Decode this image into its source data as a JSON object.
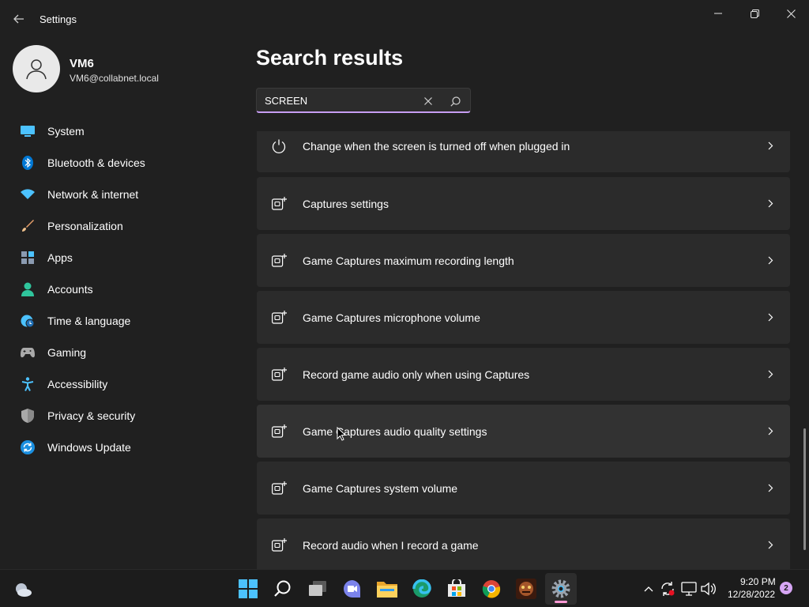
{
  "window": {
    "title": "Settings",
    "controls": [
      "minimize",
      "restore",
      "close"
    ]
  },
  "profile": {
    "name": "VM6",
    "email": "VM6@collabnet.local"
  },
  "sidebar": {
    "items": [
      {
        "label": "System",
        "icon": "system-icon"
      },
      {
        "label": "Bluetooth & devices",
        "icon": "bluetooth-icon"
      },
      {
        "label": "Network & internet",
        "icon": "wifi-icon"
      },
      {
        "label": "Personalization",
        "icon": "brush-icon"
      },
      {
        "label": "Apps",
        "icon": "apps-icon"
      },
      {
        "label": "Accounts",
        "icon": "person-icon"
      },
      {
        "label": "Time & language",
        "icon": "globe-clock-icon"
      },
      {
        "label": "Gaming",
        "icon": "gamepad-icon"
      },
      {
        "label": "Accessibility",
        "icon": "accessibility-icon"
      },
      {
        "label": "Privacy & security",
        "icon": "shield-icon"
      },
      {
        "label": "Windows Update",
        "icon": "update-icon"
      }
    ]
  },
  "main": {
    "title": "Search results",
    "search": {
      "value": "SCREEN"
    },
    "results": [
      {
        "label": "Change when the screen is turned off when plugged in",
        "icon": "power-icon"
      },
      {
        "label": "Captures settings",
        "icon": "capture-icon"
      },
      {
        "label": "Game Captures maximum recording length",
        "icon": "capture-icon"
      },
      {
        "label": "Game Captures microphone volume",
        "icon": "capture-icon"
      },
      {
        "label": "Record game audio only when using Captures",
        "icon": "capture-icon"
      },
      {
        "label": "Game Captures audio quality settings",
        "icon": "capture-icon"
      },
      {
        "label": "Game Captures system volume",
        "icon": "capture-icon"
      },
      {
        "label": "Record audio when I record a game",
        "icon": "capture-icon"
      }
    ]
  },
  "taskbar": {
    "apps": [
      "start-icon",
      "search-icon",
      "task-view-icon",
      "teams-chat-icon",
      "file-explorer-icon",
      "edge-icon",
      "store-icon",
      "chrome-icon",
      "game-app-icon",
      "settings-icon"
    ],
    "clock": {
      "time": "9:20 PM",
      "date": "12/28/2022"
    },
    "notification_count": "2"
  },
  "colors": {
    "background": "#202020",
    "card": "#2b2b2b",
    "accent": "#c79df2",
    "taskbar": "#1c1c1c"
  }
}
